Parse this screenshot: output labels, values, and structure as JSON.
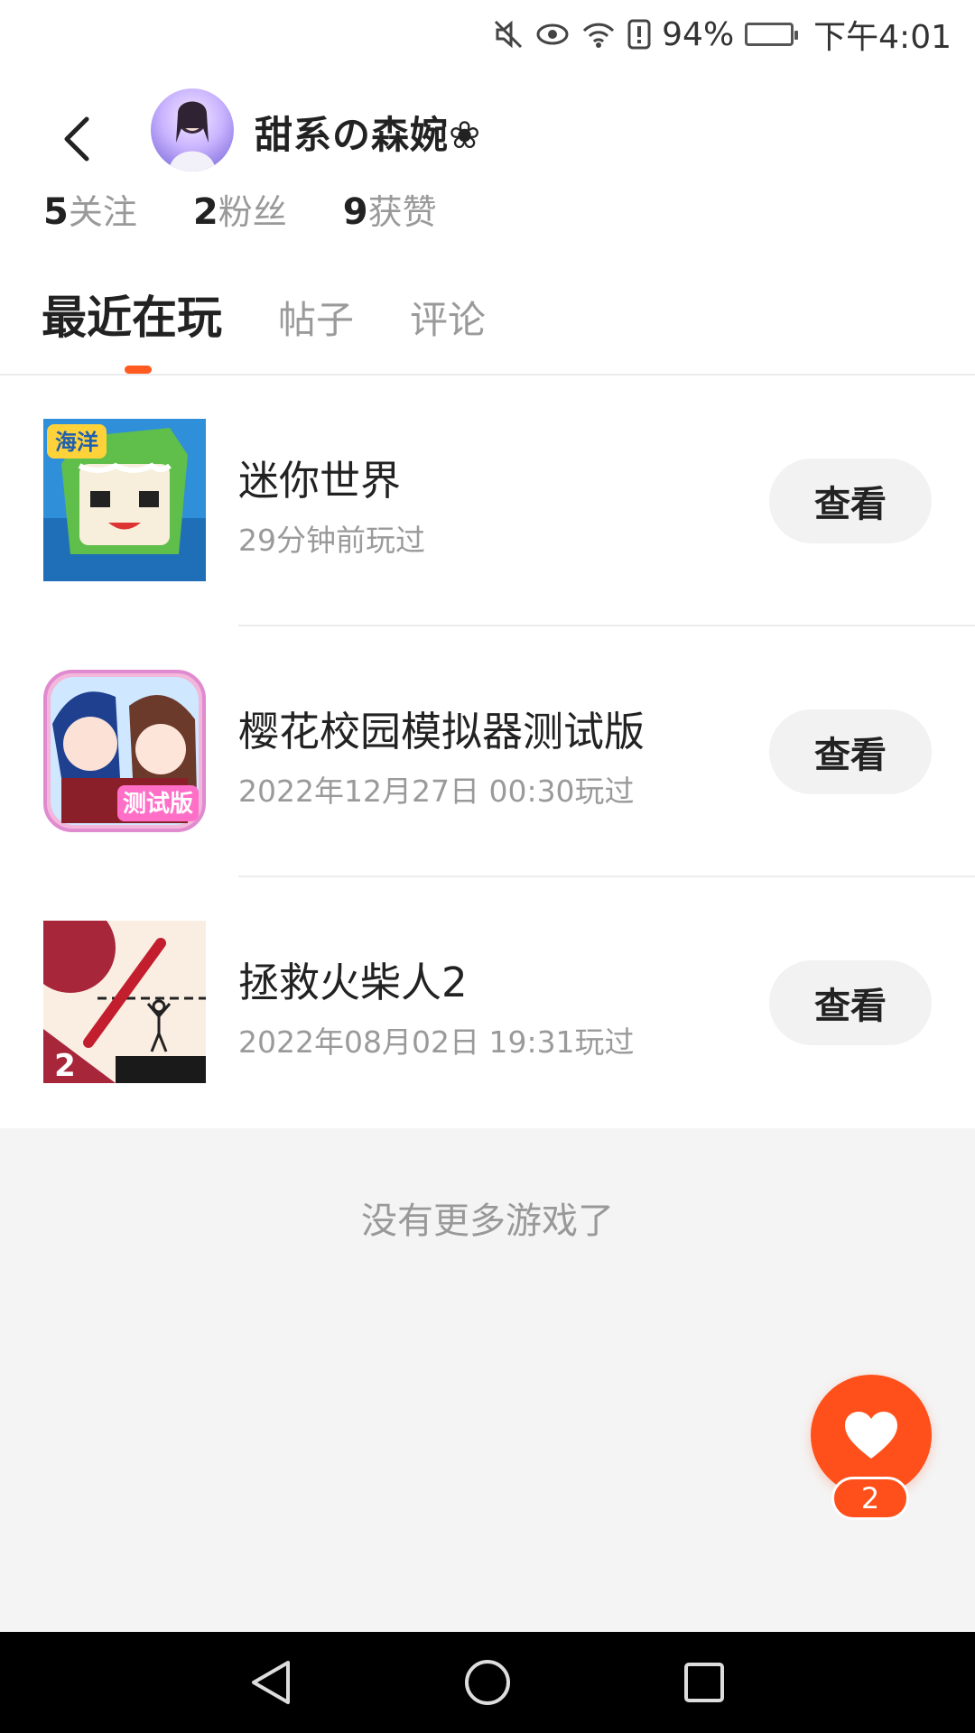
{
  "status_bar": {
    "battery_percent": "94%",
    "time": "下午4:01",
    "icons": [
      "mute-icon",
      "eye-icon",
      "wifi-icon",
      "alert-icon",
      "battery-icon"
    ]
  },
  "profile": {
    "username": "甜系の森婉❀",
    "stats": [
      {
        "num": "5",
        "label": "关注"
      },
      {
        "num": "2",
        "label": "粉丝"
      },
      {
        "num": "9",
        "label": "获赞"
      }
    ]
  },
  "tabs": [
    {
      "label": "最近在玩",
      "active": true
    },
    {
      "label": "帖子",
      "active": false
    },
    {
      "label": "评论",
      "active": false
    }
  ],
  "games": [
    {
      "title": "迷你世界",
      "time": "29分钟前玩过",
      "button": "查看",
      "icon": "mini-world-icon",
      "icon_badge": "海洋"
    },
    {
      "title": "樱花校园模拟器测试版",
      "time": "2022年12月27日 00:30玩过",
      "button": "查看",
      "icon": "sakura-school-icon",
      "icon_badge": "测试版"
    },
    {
      "title": "拯救火柴人2",
      "time": "2022年08月02日 19:31玩过",
      "button": "查看",
      "icon": "save-stickman-icon",
      "icon_badge": "2"
    }
  ],
  "footer": {
    "no_more": "没有更多游戏了"
  },
  "like": {
    "count": "2"
  },
  "colors": {
    "accent": "#ff4f1a",
    "background": "#f4f4f4"
  }
}
